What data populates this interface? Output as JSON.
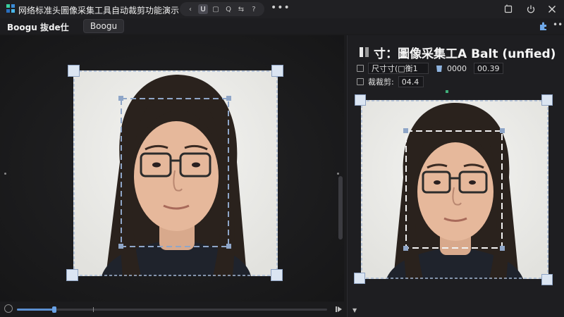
{
  "window": {
    "title": "网络标准头圖像采集工具自动裁剪功能演示",
    "toolbar_glyphs": [
      "‹",
      "U",
      "▢",
      "Q",
      "⇆",
      "?"
    ],
    "more": "•••"
  },
  "tabs": {
    "label": "Boogu 抜de仕",
    "pill": "Boogu"
  },
  "panel": {
    "heading": "寸：圖像采集工A Balt  (unfied)",
    "row1": {
      "label": "尺寸寸(□衡1",
      "value_a": "0000",
      "value_b": "00.39"
    },
    "row2": {
      "label": "裁裁剪:",
      "value": "04.4"
    }
  },
  "timeline": {
    "progress": 0.12
  },
  "colors": {
    "crop_dash": "#9bb3d6",
    "handle": "#d9e4f3",
    "accent": "#5b8fd0"
  }
}
